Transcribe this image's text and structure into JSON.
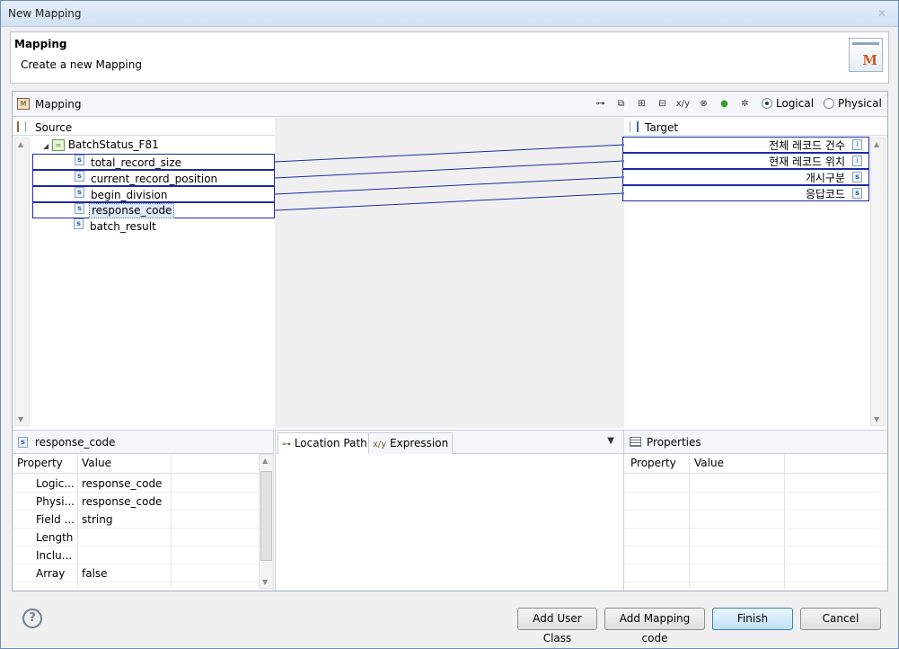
{
  "window": {
    "title": "New Mapping"
  },
  "header": {
    "title": "Mapping",
    "description": "Create a new Mapping",
    "icon": "mapping-wizard-icon"
  },
  "mapping": {
    "label": "Mapping",
    "mode_logical": "Logical",
    "mode_physical": "Physical",
    "selected_mode": "Logical"
  },
  "source": {
    "label": "Source",
    "root": "BatchStatus_F81",
    "fields": [
      "total_record_size",
      "current_record_position",
      "begin_division",
      "response_code",
      "batch_result"
    ],
    "selected": "response_code"
  },
  "target": {
    "label": "Target",
    "fields": [
      {
        "label": "전체 레코드 건수",
        "type": "i"
      },
      {
        "label": "현재 레코드 위치",
        "type": "i"
      },
      {
        "label": "개시구분",
        "type": "s"
      },
      {
        "label": "응답코드",
        "type": "s"
      }
    ]
  },
  "props_left": {
    "title": "response_code",
    "col_property": "Property",
    "col_value": "Value",
    "rows": [
      {
        "property": "Logic...",
        "value": "response_code"
      },
      {
        "property": "Physi...",
        "value": "response_code"
      },
      {
        "property": "Field ...",
        "value": "string"
      },
      {
        "property": "Length",
        "value": ""
      },
      {
        "property": "Inclu...",
        "value": ""
      },
      {
        "property": "Array",
        "value": "false"
      }
    ]
  },
  "mid_tabs": {
    "location_path": "Location Path",
    "expression": "Expression"
  },
  "props_right": {
    "title": "Properties",
    "col_property": "Property",
    "col_value": "Value"
  },
  "buttons": {
    "add_user_class": "Add User Class",
    "add_mapping_code": "Add Mapping code",
    "finish": "Finish",
    "cancel": "Cancel",
    "help": "?"
  }
}
